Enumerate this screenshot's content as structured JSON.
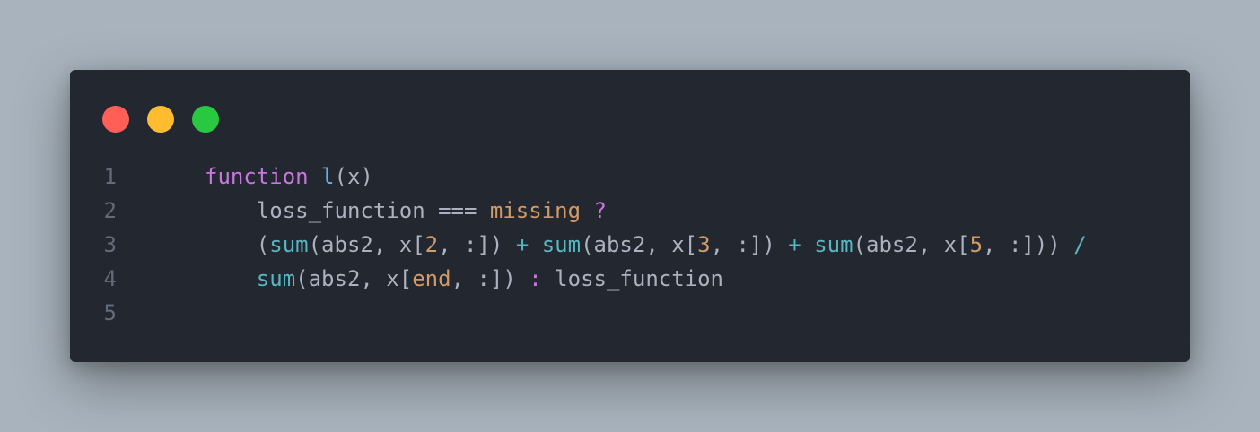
{
  "window": {
    "controls": [
      {
        "name": "close",
        "color": "#ff5f57"
      },
      {
        "name": "minimize",
        "color": "#febc2e"
      },
      {
        "name": "maximize",
        "color": "#28c840"
      }
    ]
  },
  "code": {
    "line_numbers": [
      "1",
      "2",
      "3",
      "4",
      "5"
    ],
    "lines": [
      {
        "tokens": [
          {
            "t": "function",
            "c": "kw"
          },
          {
            "t": " ",
            "c": ""
          },
          {
            "t": "l",
            "c": "fn"
          },
          {
            "t": "(x)",
            "c": ""
          }
        ]
      },
      {
        "tokens": [
          {
            "t": "    loss_function === ",
            "c": ""
          },
          {
            "t": "missing",
            "c": "num"
          },
          {
            "t": " ",
            "c": ""
          },
          {
            "t": "?",
            "c": "tern"
          }
        ]
      },
      {
        "tokens": [
          {
            "t": "    (",
            "c": ""
          },
          {
            "t": "sum",
            "c": "call"
          },
          {
            "t": "(abs2, x[",
            "c": ""
          },
          {
            "t": "2",
            "c": "num"
          },
          {
            "t": ", :]) ",
            "c": ""
          },
          {
            "t": "+",
            "c": "op"
          },
          {
            "t": " ",
            "c": ""
          },
          {
            "t": "sum",
            "c": "call"
          },
          {
            "t": "(abs2, x[",
            "c": ""
          },
          {
            "t": "3",
            "c": "num"
          },
          {
            "t": ", :]) ",
            "c": ""
          },
          {
            "t": "+",
            "c": "op"
          },
          {
            "t": " ",
            "c": ""
          },
          {
            "t": "sum",
            "c": "call"
          },
          {
            "t": "(abs2, x[",
            "c": ""
          },
          {
            "t": "5",
            "c": "num"
          },
          {
            "t": ", :])) ",
            "c": ""
          },
          {
            "t": "/",
            "c": "op"
          }
        ]
      },
      {
        "tokens": [
          {
            "t": "    ",
            "c": ""
          },
          {
            "t": "sum",
            "c": "call"
          },
          {
            "t": "(abs2, x[",
            "c": ""
          },
          {
            "t": "end",
            "c": "num"
          },
          {
            "t": ", :]) ",
            "c": ""
          },
          {
            "t": ":",
            "c": "tern"
          },
          {
            "t": " loss_function",
            "c": ""
          }
        ]
      },
      {
        "tokens": []
      }
    ]
  }
}
